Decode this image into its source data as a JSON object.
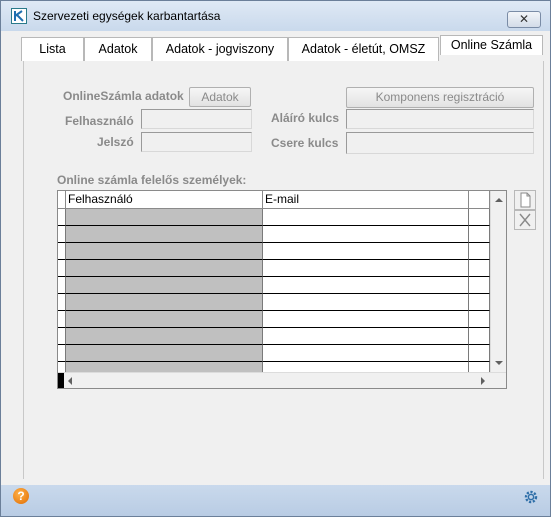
{
  "window": {
    "title": "Szervezeti egységek karbantartása",
    "close_glyph": "✕"
  },
  "tabs": [
    {
      "label": "Lista"
    },
    {
      "label": "Adatok"
    },
    {
      "label": "Adatok - jogviszony"
    },
    {
      "label": "Adatok - életút, OMSZ"
    },
    {
      "label": "Online Számla"
    }
  ],
  "form": {
    "section_label": "OnlineSzámla adatok",
    "data_button": "Adatok",
    "register_button": "Komponens regisztráció",
    "user_label": "Felhasználó",
    "password_label": "Jelszó",
    "signing_key_label": "Aláíró kulcs",
    "exchange_key_label": "Csere kulcs",
    "user_value": "",
    "password_value": "",
    "signing_key_value": "",
    "exchange_key_value": ""
  },
  "grid": {
    "caption": "Online számla felelős személyek:",
    "columns": [
      "Felhasználó",
      "E-mail"
    ],
    "rows": [
      [
        "",
        ""
      ],
      [
        "",
        ""
      ],
      [
        "",
        ""
      ],
      [
        "",
        ""
      ],
      [
        "",
        ""
      ],
      [
        "",
        ""
      ],
      [
        "",
        ""
      ],
      [
        "",
        ""
      ],
      [
        "",
        ""
      ],
      [
        "",
        ""
      ]
    ]
  },
  "icons": {
    "app": "app-logo-icon",
    "new": "new-document-icon",
    "delete": "delete-x-icon",
    "help": "help-icon",
    "settings": "gear-icon"
  },
  "colors": {
    "title_gradient_top": "#dfe9f5",
    "label_gray": "#8a8a8a",
    "user_cell_fill": "#c0c0c0",
    "help_orange": "#e06b00"
  },
  "statusbar": {
    "help_glyph": "?"
  }
}
